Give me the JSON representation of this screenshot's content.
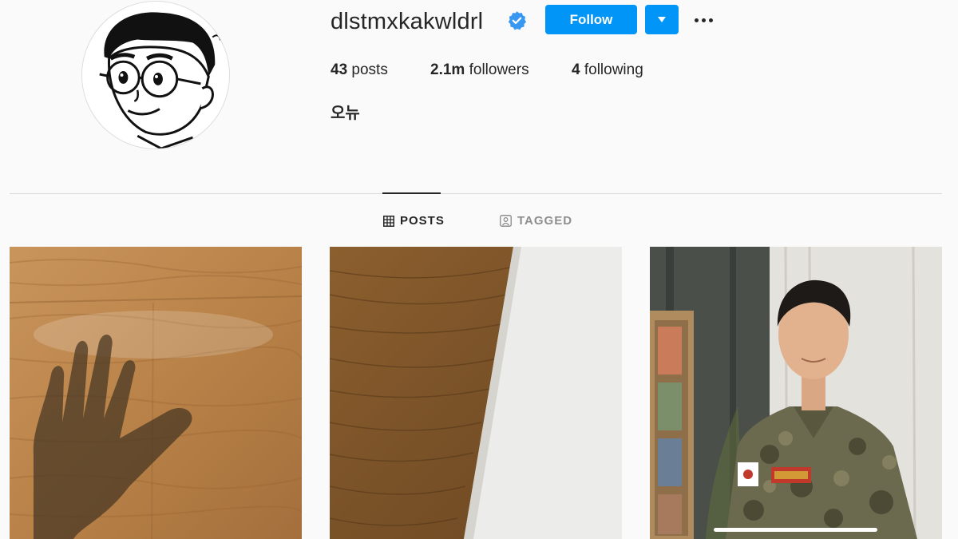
{
  "profile": {
    "username": "dlstmxkakwldrl",
    "verified": true,
    "full_name": "오뉴",
    "avatar_icon": "cartoon-avatar"
  },
  "actions": {
    "follow_label": "Follow",
    "dropdown_icon": "caret-down-icon",
    "more_icon": "more-options-icon"
  },
  "stats": {
    "posts_count": "43",
    "posts_label": "posts",
    "followers_count": "2.1m",
    "followers_label": "followers",
    "following_count": "4",
    "following_label": "following"
  },
  "tabs": [
    {
      "label": "POSTS",
      "icon": "grid-icon",
      "active": true
    },
    {
      "label": "TAGGED",
      "icon": "tagged-icon",
      "active": false
    }
  ],
  "posts": [
    {
      "description_icon": "hand-shadow-on-wood-photo"
    },
    {
      "description_icon": "wood-and-paper-photo"
    },
    {
      "description_icon": "man-in-uniform-photo"
    }
  ],
  "colors": {
    "accent": "#0095f6",
    "verified": "#3897f0",
    "text": "#262626",
    "muted": "#8e8e8e",
    "background": "#fafafa"
  }
}
